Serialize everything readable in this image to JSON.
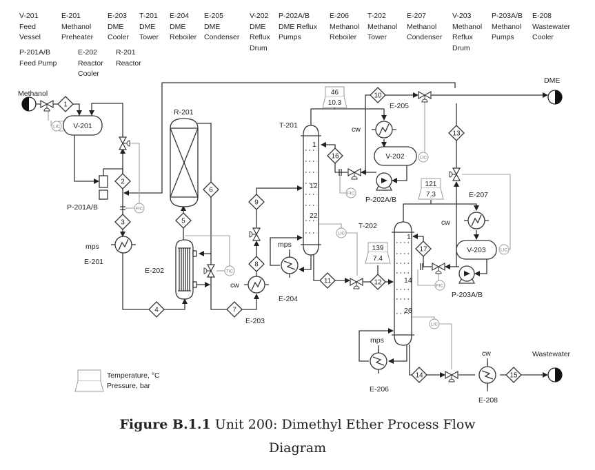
{
  "header": [
    {
      "lines": [
        "V-201",
        "Feed",
        "Vessel"
      ]
    },
    {
      "lines": [
        "E-201",
        "Methanol",
        "Preheater"
      ]
    },
    {
      "lines": [
        "E-203",
        "DME",
        "Cooler"
      ]
    },
    {
      "lines": [
        "T-201",
        "DME",
        "Tower"
      ]
    },
    {
      "lines": [
        "E-204",
        "DME",
        "Reboiler"
      ]
    },
    {
      "lines": [
        "E-205",
        "DME",
        "Condenser"
      ]
    },
    {
      "lines": [
        "V-202",
        "DME",
        "Reflux",
        "Drum"
      ]
    },
    {
      "lines": [
        "P-202A/B",
        "DME Reflux",
        "Pumps"
      ]
    },
    {
      "lines": [
        "E-206",
        "Methanol",
        "Reboiler"
      ]
    },
    {
      "lines": [
        "T-202",
        "Methanol",
        "Tower"
      ]
    },
    {
      "lines": [
        "E-207",
        "Methanol",
        "Condenser"
      ]
    },
    {
      "lines": [
        "V-203",
        "Methanol",
        "Reflux",
        "Drum"
      ]
    },
    {
      "lines": [
        "P-203A/B",
        "Methanol",
        "Pumps"
      ]
    },
    {
      "lines": [
        "E-208",
        "Wastewater",
        "Cooler"
      ]
    },
    {
      "lines": [
        "P-201A/B",
        "Feed Pump"
      ]
    },
    {
      "lines": [
        "E-202",
        "Reactor",
        "Cooler"
      ]
    },
    {
      "lines": [
        "R-201",
        "Reactor"
      ]
    }
  ],
  "diagram": {
    "feeds": {
      "methanol": "Methanol",
      "dme": "DME",
      "wastewater": "Wastewater"
    },
    "equipment": {
      "v201": "V-201",
      "p201": "P-201A/B",
      "e201": "E-201",
      "e202": "E-202",
      "r201": "R-201",
      "e203": "E-203",
      "t201": "T-201",
      "e204": "E-204",
      "e205": "E-205",
      "v202": "V-202",
      "p202": "P-202A/B",
      "t202": "T-202",
      "e206": "E-206",
      "e207": "E-207",
      "v203": "V-203",
      "p203": "P-203A/B",
      "e208": "E-208"
    },
    "streams": [
      "1",
      "2",
      "3",
      "4",
      "5",
      "6",
      "7",
      "8",
      "9",
      "10",
      "11",
      "12",
      "13",
      "14",
      "15",
      "16",
      "17"
    ],
    "utilities": {
      "mps": "mps",
      "cw": "cw"
    },
    "instruments": {
      "lic": "LIC",
      "fic": "FIC",
      "tic": "TIC"
    },
    "trays": {
      "t201": [
        "1",
        "12",
        "22"
      ],
      "t202": [
        "1",
        "14",
        "26"
      ]
    },
    "tp_boxes": [
      {
        "temperature": "46",
        "pressure": "10.3"
      },
      {
        "temperature": "139",
        "pressure": "7.4"
      },
      {
        "temperature": "121",
        "pressure": "7.3"
      }
    ],
    "legend": {
      "temperature": "Temperature, °C",
      "pressure": "Pressure, bar"
    }
  },
  "caption": {
    "label": "Figure B.1.1",
    "text": "Unit 200: Dimethyl Ether Process Flow",
    "text2": "Diagram"
  }
}
